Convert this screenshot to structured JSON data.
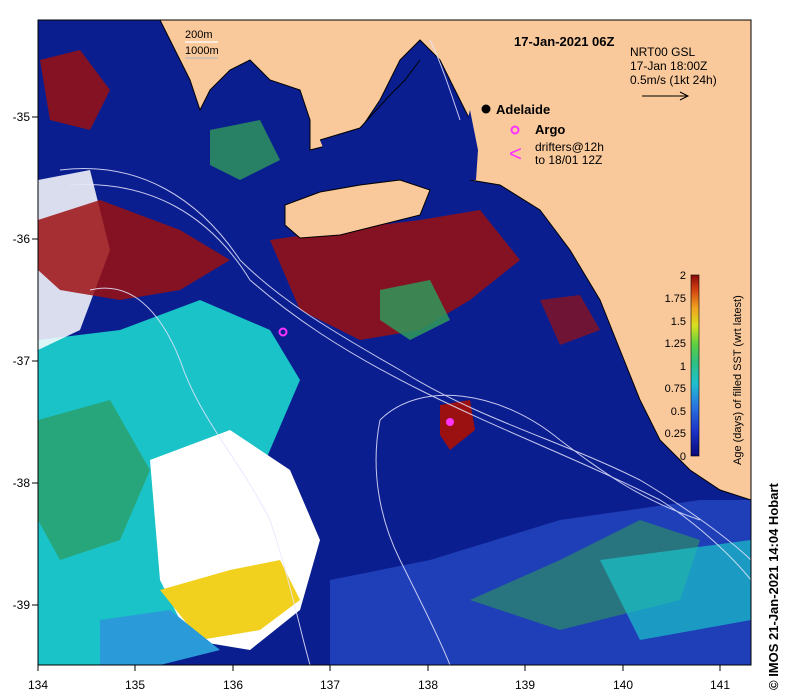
{
  "map": {
    "title": "17-Jan-2021 06Z",
    "product_lines": [
      "NRT00 GSL",
      "17-Jan 18:00Z",
      "0.5m/s (1kt 24h)"
    ],
    "isobaths": [
      "200m",
      "1000m"
    ],
    "city": "Adelaide",
    "legend": {
      "argo_label": "Argo",
      "drifters_line1": "drifters@12h",
      "drifters_line2": "to 18/01 12Z",
      "drifter_symbol": "<"
    },
    "x_ticks": [
      "134",
      "135",
      "136",
      "137",
      "138",
      "139",
      "140",
      "141"
    ],
    "y_ticks": [
      "-35",
      "-36",
      "-37",
      "-38",
      "-39"
    ],
    "colorbar": {
      "label": "Age (days) of filled SST (wrt latest)",
      "ticks": [
        "2",
        "1.75",
        "1.5",
        "1.25",
        "1",
        "0.75",
        "0.5",
        "0.25",
        "0"
      ]
    },
    "credit": "© IMOS 21-Jan-2021 14:04 Hobart",
    "colors": {
      "land": "#f9c89b",
      "ocean_fresh": "#0b1e8f",
      "argo": "#ff33ff"
    }
  }
}
